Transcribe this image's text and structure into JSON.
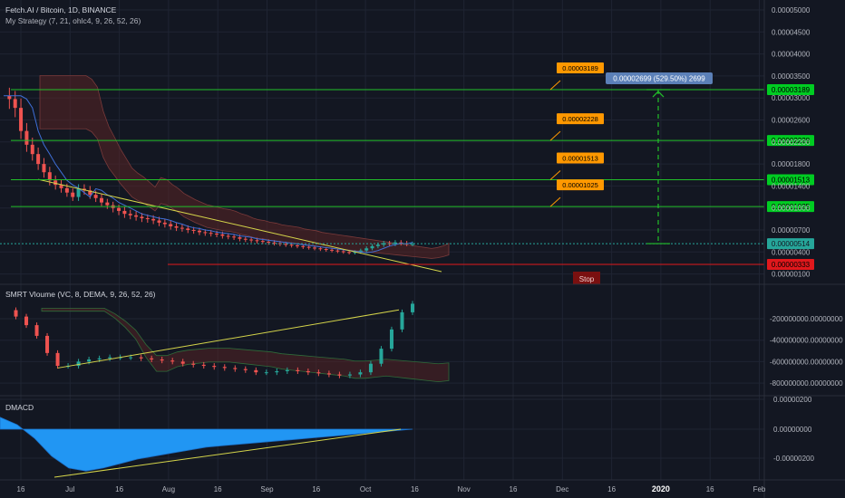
{
  "header": {
    "symbol_title": "Fetch.AI / Bitcoin, 1D, BINANCE",
    "strategy_label": "My Strategy (7, 21, ohlc4, 9, 26, 52, 26)",
    "volume_label": "SMRT Vloume (VC, 8, DEMA, 9, 26, 52, 26)",
    "macd_label": "DMACD"
  },
  "colors": {
    "background": "#131722",
    "grid": "#1f2433",
    "axis_text": "#b2b5be",
    "green_line": "#22c02a",
    "green_label": "#00cc22",
    "red_line": "#e0181c",
    "red_label": "#e0181c",
    "callout_orange": "#ff9800",
    "measure_label": "#5b80b8",
    "last_price": "#26a69a",
    "macd_fill": "#2196f3",
    "cloud": "#5a2424",
    "trend_yellow": "#d4d44a",
    "stop_marker": "#7a1010"
  },
  "chart_data": [
    {
      "type": "line",
      "pane": "price",
      "title": "Fetch.AI / Bitcoin, 1D, BINANCE",
      "y_ticks": [
        "0.00005000",
        "0.00004500",
        "0.00004000",
        "0.00003500",
        "0.00003000",
        "0.00002600",
        "0.00002200",
        "0.00001800",
        "0.00001400",
        "0.00001000",
        "0.00000700",
        "0.00000400",
        "0.00000100"
      ],
      "x_ticks": [
        "16",
        "Jul",
        "16",
        "Aug",
        "16",
        "Sep",
        "16",
        "Oct",
        "16",
        "Nov",
        "16",
        "Dec",
        "16",
        "2020",
        "16",
        "Feb"
      ],
      "levels": [
        {
          "value": "0.00003189",
          "kind": "target"
        },
        {
          "value": "0.00002228",
          "kind": "target"
        },
        {
          "value": "0.00001513",
          "kind": "target"
        },
        {
          "value": "0.00001025",
          "kind": "target"
        },
        {
          "value": "0.00000514",
          "kind": "last"
        },
        {
          "value": "0.00000333",
          "kind": "stop"
        }
      ],
      "measure_label": "0.00002699 (529.50%) 2699",
      "stop_label": "Stop",
      "close_approx": [
        3.05e-05,
        2.98e-05,
        2.82e-05,
        2.4e-05,
        2.15e-05,
        1.98e-05,
        1.8e-05,
        1.65e-05,
        1.5e-05,
        1.42e-05,
        1.36e-05,
        1.28e-05,
        1.2e-05,
        1.35e-05,
        1.32e-05,
        1.24e-05,
        1.18e-05,
        1.1e-05,
        1.05e-05,
        1e-05,
        9.6e-06,
        9.2e-06,
        9e-06,
        8.8e-06,
        8.6e-06,
        8.5e-06,
        8.3e-06,
        8e-06,
        7.8e-06,
        7.5e-06,
        7.3e-06,
        7.2e-06,
        7e-06,
        6.9e-06,
        6.7e-06,
        6.6e-06,
        6.5e-06,
        6.4e-06,
        6.2e-06,
        6.1e-06,
        6e-06,
        5.8e-06,
        5.7e-06,
        5.6e-06,
        5.5e-06,
        5.4e-06,
        5.3e-06,
        5.2e-06,
        5.1e-06,
        5e-06,
        4.9e-06,
        4.8e-06,
        4.7e-06,
        4.6e-06,
        4.5e-06,
        4.4e-06,
        4.3e-06,
        4.2e-06,
        4.1e-06,
        4e-06,
        3.9e-06,
        4e-06,
        4.2e-06,
        4.5e-06,
        4.8e-06,
        5e-06,
        5.2e-06,
        5.1e-06,
        5.3e-06,
        5.2e-06,
        5.1e-06,
        5.1e-06
      ]
    },
    {
      "type": "line",
      "pane": "volume",
      "title": "SMRT Vloume (VC, 8, DEMA, 9, 26, 52, 26)",
      "y_ticks": [
        "-200000000.00000000",
        "-400000000.00000000",
        "-600000000.00000000",
        "-800000000.00000000"
      ],
      "values_approx": [
        -120000000,
        -180000000,
        -260000000,
        -360000000,
        -520000000,
        -640000000,
        -640000000,
        -600000000,
        -580000000,
        -570000000,
        -560000000,
        -560000000,
        -560000000,
        -570000000,
        -580000000,
        -590000000,
        -600000000,
        -620000000,
        -630000000,
        -640000000,
        -650000000,
        -660000000,
        -670000000,
        -680000000,
        -700000000,
        -700000000,
        -690000000,
        -680000000,
        -690000000,
        -700000000,
        -710000000,
        -720000000,
        -730000000,
        -720000000,
        -700000000,
        -620000000,
        -480000000,
        -300000000,
        -140000000,
        -60000000
      ]
    },
    {
      "type": "area",
      "pane": "macd",
      "title": "DMACD",
      "y_ticks": [
        "0.00000200",
        "0.00000000",
        "-0.00000200"
      ],
      "values_approx": [
        8e-07,
        3e-07,
        -6e-07,
        -1.8e-06,
        -2.6e-06,
        -2.8e-06,
        -2.6e-06,
        -2.3e-06,
        -2e-06,
        -1.8e-06,
        -1.6e-06,
        -1.4e-06,
        -1.2e-06,
        -1.1e-06,
        -1e-06,
        -9e-07,
        -8e-07,
        -7e-07,
        -6e-07,
        -5e-07,
        -4e-07,
        -3e-07,
        -2e-07,
        -1e-07,
        0.0
      ]
    }
  ]
}
